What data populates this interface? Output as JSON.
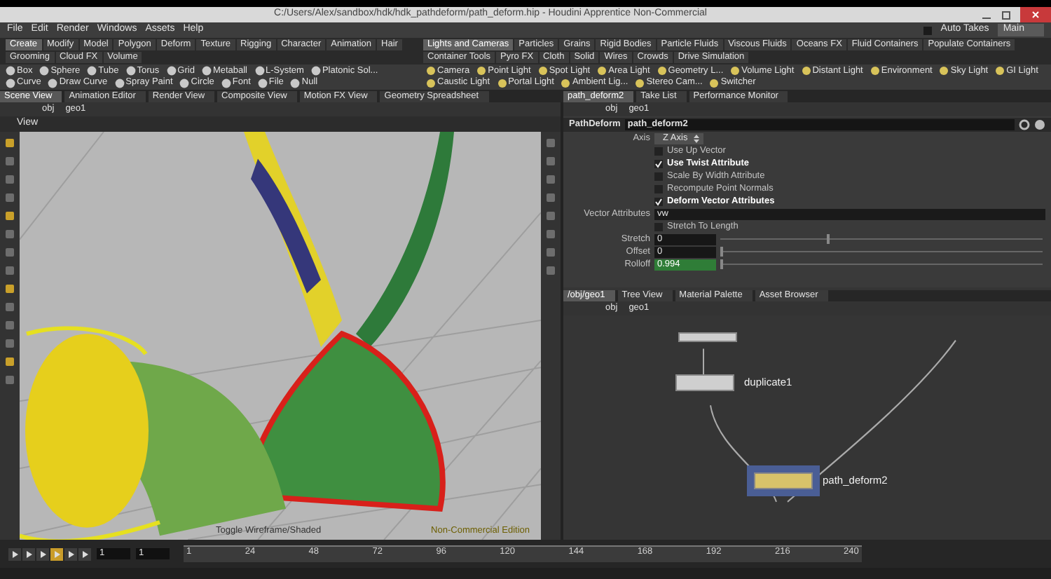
{
  "window": {
    "title": "C:/Users/Alex/sandbox/hdk/hdk_pathdeform/path_deform.hip - Houdini Apprentice Non-Commercial"
  },
  "menu": [
    "File",
    "Edit",
    "Render",
    "Windows",
    "Assets",
    "Help"
  ],
  "auto_takes": {
    "label": "Auto Takes",
    "checked": false
  },
  "desktop": "Main",
  "shelf_tabs_left": [
    {
      "label": "Create",
      "selected": true
    },
    {
      "label": "Modify",
      "selected": false
    },
    {
      "label": "Model",
      "selected": false
    },
    {
      "label": "Polygon",
      "selected": false
    },
    {
      "label": "Deform",
      "selected": false
    },
    {
      "label": "Texture",
      "selected": false
    },
    {
      "label": "Rigging",
      "selected": false
    },
    {
      "label": "Character",
      "selected": false
    },
    {
      "label": "Animation",
      "selected": false
    },
    {
      "label": "Hair",
      "selected": false
    },
    {
      "label": "Grooming",
      "selected": false
    },
    {
      "label": "Cloud FX",
      "selected": false
    },
    {
      "label": "Volume",
      "selected": false
    }
  ],
  "shelf_tabs_right": [
    {
      "label": "Lights and Cameras",
      "selected": true
    },
    {
      "label": "Particles",
      "selected": false
    },
    {
      "label": "Grains",
      "selected": false
    },
    {
      "label": "Rigid Bodies",
      "selected": false
    },
    {
      "label": "Particle Fluids",
      "selected": false
    },
    {
      "label": "Viscous Fluids",
      "selected": false
    },
    {
      "label": "Oceans FX",
      "selected": false
    },
    {
      "label": "Fluid Containers",
      "selected": false
    },
    {
      "label": "Populate Containers",
      "selected": false
    },
    {
      "label": "Container Tools",
      "selected": false
    },
    {
      "label": "Pyro FX",
      "selected": false
    },
    {
      "label": "Cloth",
      "selected": false
    },
    {
      "label": "Solid",
      "selected": false
    },
    {
      "label": "Wires",
      "selected": false
    },
    {
      "label": "Crowds",
      "selected": false
    },
    {
      "label": "Drive Simulation",
      "selected": false
    }
  ],
  "shelf_tools_left": [
    "Box",
    "Sphere",
    "Tube",
    "Torus",
    "Grid",
    "Metaball",
    "L-System",
    "Platonic Sol...",
    "Curve",
    "Draw Curve",
    "Spray Paint",
    "Circle",
    "Font",
    "File",
    "Null"
  ],
  "shelf_tools_right": [
    "Camera",
    "Point Light",
    "Spot Light",
    "Area Light",
    "Geometry L...",
    "Volume Light",
    "Distant Light",
    "Environment",
    "Sky Light",
    "GI Light",
    "Caustic Light",
    "Portal Light",
    "Ambient Lig...",
    "Stereo Cam...",
    "Switcher"
  ],
  "pane_tabs_left": [
    {
      "label": "Scene View",
      "selected": true
    },
    {
      "label": "Animation Editor",
      "selected": false
    },
    {
      "label": "Render View",
      "selected": false
    },
    {
      "label": "Composite View",
      "selected": false
    },
    {
      "label": "Motion FX View",
      "selected": false
    },
    {
      "label": "Geometry Spreadsheet",
      "selected": false
    }
  ],
  "pane_tabs_right": [
    {
      "label": "path_deform2",
      "selected": true
    },
    {
      "label": "Take List",
      "selected": false
    },
    {
      "label": "Performance Monitor",
      "selected": false
    }
  ],
  "scene_view": {
    "path": [
      "obj",
      "geo1"
    ],
    "header": "View",
    "footer_left": "Toggle Wireframe/Shaded",
    "footer_right": "Non-Commercial Edition"
  },
  "parameters": {
    "path": [
      "obj",
      "geo1"
    ],
    "node_type": "PathDeform",
    "node_name": "path_deform2",
    "axis": {
      "label": "Axis",
      "value": "Z Axis"
    },
    "toggles": [
      {
        "label": "Use Up Vector",
        "checked": false
      },
      {
        "label": "Use Twist Attribute",
        "checked": true
      },
      {
        "label": "Scale By Width Attribute",
        "checked": false
      },
      {
        "label": "Recompute Point Normals",
        "checked": false
      },
      {
        "label": "Deform Vector Attributes",
        "checked": true
      }
    ],
    "vector_attributes": {
      "label": "Vector Attributes",
      "value": "vw"
    },
    "stretch_to_length": {
      "label": "Stretch To Length",
      "checked": false
    },
    "sliders": [
      {
        "label": "Stretch",
        "value": "0",
        "level": 0.33,
        "selected": false
      },
      {
        "label": "Offset",
        "value": "0",
        "level": 0,
        "selected": false
      },
      {
        "label": "Rolloff",
        "value": "0.994",
        "level": 0,
        "selected": true
      }
    ]
  },
  "network": {
    "tabs": [
      {
        "label": "/obj/geo1",
        "selected": true
      },
      {
        "label": "Tree View",
        "selected": false
      },
      {
        "label": "Material Palette",
        "selected": false
      },
      {
        "label": "Asset Browser",
        "selected": false
      }
    ],
    "path": [
      "obj",
      "geo1"
    ],
    "nodes": [
      {
        "label": "duplicate1",
        "selected": false
      },
      {
        "label": "path_deform2",
        "selected": true
      }
    ]
  },
  "timeline": {
    "frame": "1",
    "step": "1",
    "ticks": [
      "1",
      "24",
      "48",
      "72",
      "96",
      "120",
      "144",
      "168",
      "192",
      "216",
      "240"
    ]
  }
}
